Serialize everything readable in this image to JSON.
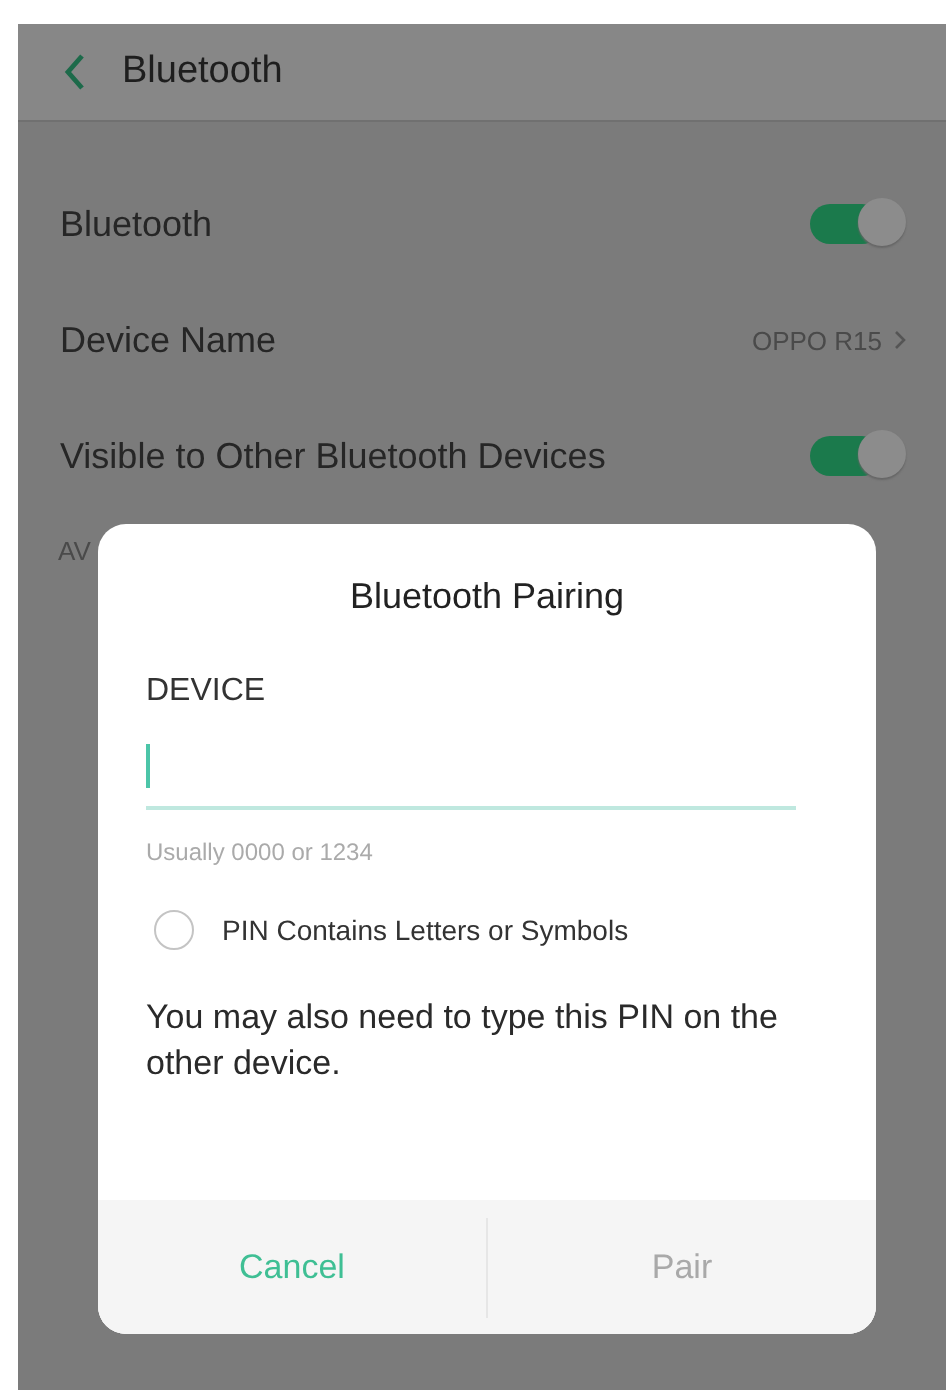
{
  "header": {
    "title": "Bluetooth"
  },
  "settings": [
    {
      "kind": "toggle",
      "label": "Bluetooth",
      "on": true
    },
    {
      "kind": "value",
      "label": "Device Name",
      "value": "OPPO R15"
    },
    {
      "kind": "toggle",
      "label": "Visible to Other Bluetooth Devices",
      "on": true
    }
  ],
  "section_header": "AV",
  "dialog": {
    "title": "Bluetooth Pairing",
    "field_label": "DEVICE",
    "hint": "Usually 0000 or 1234",
    "option": {
      "label": "PIN Contains Letters or Symbols",
      "checked": false
    },
    "message": "You may also need to type this PIN on the other device.",
    "buttons": [
      {
        "label": "Cancel",
        "disabled": false
      },
      {
        "label": "Pair",
        "disabled": true
      }
    ]
  }
}
